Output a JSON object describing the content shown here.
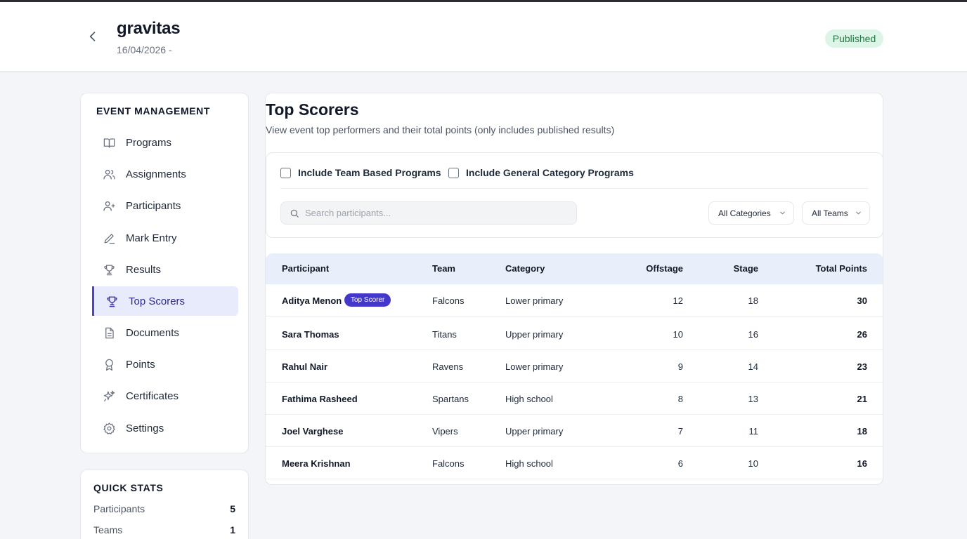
{
  "header": {
    "title": "gravitas",
    "date": "16/04/2026 -",
    "status": "Published",
    "back_icon": "chevron-left-icon"
  },
  "sidebar": {
    "heading": "EVENT MANAGEMENT",
    "items": [
      {
        "label": "Programs",
        "icon": "book-open-icon"
      },
      {
        "label": "Assignments",
        "icon": "users-icon"
      },
      {
        "label": "Participants",
        "icon": "user-plus-icon"
      },
      {
        "label": "Mark Entry",
        "icon": "pencil-icon"
      },
      {
        "label": "Results",
        "icon": "trophy-icon"
      },
      {
        "label": "Top Scorers",
        "icon": "trophy-icon",
        "active": true
      },
      {
        "label": "Documents",
        "icon": "document-icon"
      },
      {
        "label": "Points",
        "icon": "award-icon"
      },
      {
        "label": "Certificates",
        "icon": "sparkles-icon"
      },
      {
        "label": "Settings",
        "icon": "gear-icon"
      }
    ]
  },
  "quick_stats": {
    "heading": "QUICK STATS",
    "rows": [
      {
        "label": "Participants",
        "value": "5"
      },
      {
        "label": "Teams",
        "value": "1"
      }
    ]
  },
  "main": {
    "title": "Top Scorers",
    "subtitle": "View event top performers and their total points (only includes published results)",
    "filters": {
      "team_based": "Include Team Based Programs",
      "general_category": "Include General Category Programs",
      "search_placeholder": "Search participants...",
      "category_select": "All Categories",
      "team_select": "All Teams"
    },
    "table": {
      "columns": [
        "Participant",
        "Team",
        "Category",
        "Offstage",
        "Stage",
        "Total Points"
      ],
      "top_badge": "Top Scorer",
      "rows": [
        {
          "name": "Aditya Menon",
          "team": "Falcons",
          "category": "Lower primary",
          "offstage": "12",
          "stage": "18",
          "total": "30"
        },
        {
          "name": "Sara Thomas",
          "team": "Titans",
          "category": "Upper primary",
          "offstage": "10",
          "stage": "16",
          "total": "26"
        },
        {
          "name": "Rahul Nair",
          "team": "Ravens",
          "category": "Lower primary",
          "offstage": "9",
          "stage": "14",
          "total": "23"
        },
        {
          "name": "Fathima Rasheed",
          "team": "Spartans",
          "category": "High school",
          "offstage": "8",
          "stage": "13",
          "total": "21"
        },
        {
          "name": "Joel Varghese",
          "team": "Vipers",
          "category": "Upper primary",
          "offstage": "7",
          "stage": "11",
          "total": "18"
        },
        {
          "name": "Meera Krishnan",
          "team": "Falcons",
          "category": "High school",
          "offstage": "6",
          "stage": "10",
          "total": "16"
        }
      ]
    }
  },
  "colors": {
    "accent": "#4c45c8",
    "active_bg": "#e7ebfb",
    "published_bg": "#dcf5e6",
    "published_text": "#1f7a45"
  }
}
